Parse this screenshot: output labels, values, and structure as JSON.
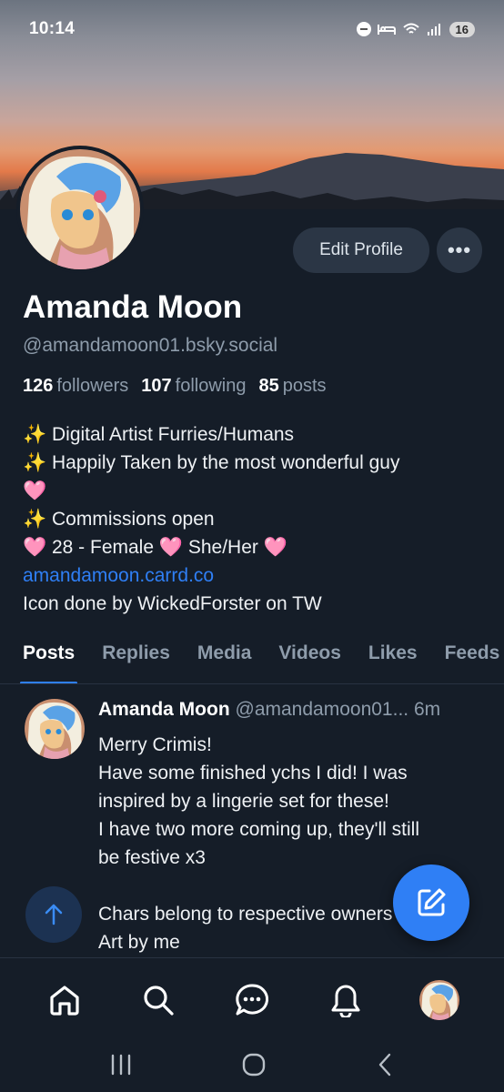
{
  "status_bar": {
    "time": "10:14",
    "battery": "16"
  },
  "profile": {
    "display_name": "Amanda Moon",
    "handle": "@amandamoon01.bsky.social",
    "edit_label": "Edit Profile",
    "more_label": "•••",
    "followers_count": "126",
    "followers_label": "followers",
    "following_count": "107",
    "following_label": "following",
    "posts_count": "85",
    "posts_label": "posts",
    "bio": [
      "✨ Digital Artist Furries/Humans",
      "✨ Happily Taken by the most wonderful guy",
      "🩷",
      "✨ Commissions open",
      "🩷 28 - Female 🩷 She/Her 🩷"
    ],
    "link": "amandamoon.carrd.co",
    "icon_credit": "Icon done by WickedForster on TW"
  },
  "tabs": [
    "Posts",
    "Replies",
    "Media",
    "Videos",
    "Likes",
    "Feeds"
  ],
  "post": {
    "author": "Amanda Moon",
    "meta": "@amandamoon01... 6m",
    "lines": [
      "Merry Crimis!",
      "Have some finished ychs I did! I was",
      "inspired by a lingerie set for these!",
      "I have two more coming up, they'll still",
      "be festive x3",
      "",
      "Chars belong to respective owners 🩷",
      "Art by me"
    ]
  },
  "colors": {
    "accent": "#2f7ff5",
    "background": "#151d28",
    "muted": "#8e9cab"
  },
  "icons": {
    "nav": [
      "home-icon",
      "search-icon",
      "chat-icon",
      "bell-icon",
      "avatar"
    ],
    "system": [
      "recents-icon",
      "home-circle-icon",
      "back-icon"
    ]
  }
}
